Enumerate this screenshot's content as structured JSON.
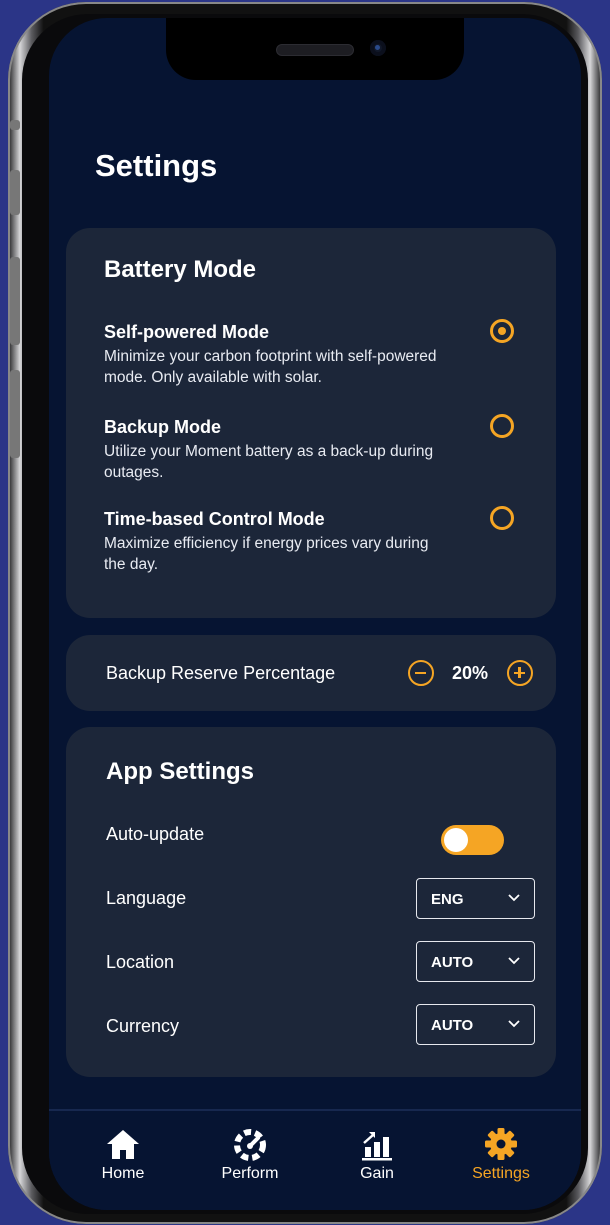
{
  "page": {
    "title": "Settings"
  },
  "battery_mode": {
    "title": "Battery Mode",
    "modes": [
      {
        "name": "Self-powered Mode",
        "description": "Minimize your carbon footprint with self-powered mode. Only available with solar.",
        "selected": true
      },
      {
        "name": "Backup Mode",
        "description": "Utilize your Moment battery as a back-up during outages.",
        "selected": false
      },
      {
        "name": "Time-based Control Mode",
        "description": "Maximize efficiency if energy prices vary during the day.",
        "selected": false
      }
    ]
  },
  "backup_reserve": {
    "label": "Backup Reserve Percentage",
    "value": "20%"
  },
  "app_settings": {
    "title": "App Settings",
    "auto_update": {
      "label": "Auto-update",
      "enabled": true
    },
    "language": {
      "label": "Language",
      "value": "ENG"
    },
    "location": {
      "label": "Location",
      "value": "AUTO"
    },
    "currency": {
      "label": "Currency",
      "value": "AUTO"
    }
  },
  "tabbar": {
    "tabs": [
      {
        "label": "Home",
        "icon": "home-icon",
        "active": false
      },
      {
        "label": "Perform",
        "icon": "gauge-icon",
        "active": false
      },
      {
        "label": "Gain",
        "icon": "bar-chart-icon",
        "active": false
      },
      {
        "label": "Settings",
        "icon": "gear-icon",
        "active": true
      }
    ]
  },
  "colors": {
    "accent": "#f5a524",
    "background": "#061432",
    "card": "#1c2639",
    "frame": "#2b3587"
  }
}
